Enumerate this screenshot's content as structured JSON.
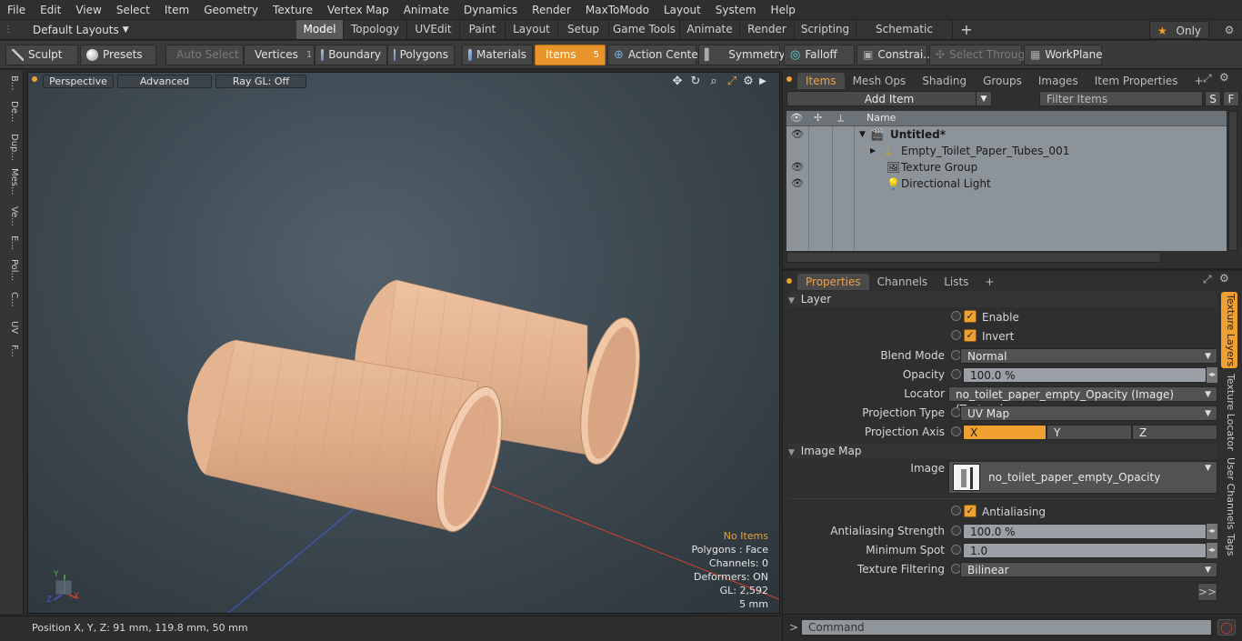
{
  "menu": [
    "File",
    "Edit",
    "View",
    "Select",
    "Item",
    "Geometry",
    "Texture",
    "Vertex Map",
    "Animate",
    "Dynamics",
    "Render",
    "MaxToModo",
    "Layout",
    "System",
    "Help"
  ],
  "layout_bar": {
    "layouts_label": "Default Layouts",
    "tabs": [
      "Model",
      "Topology",
      "UVEdit",
      "Paint",
      "Layout",
      "Setup",
      "Game Tools",
      "Animate",
      "Render",
      "Scripting",
      "Schematic Fusion"
    ],
    "active_tab": "Model",
    "add_label": "+",
    "only_label": "Only"
  },
  "toolbar": {
    "sculpt": "Sculpt",
    "presets": "Presets",
    "auto_select": "Auto Select",
    "vertices": "Vertices",
    "vertices_count": "1",
    "boundary": "Boundary",
    "polygons": "Polygons",
    "materials": "Materials",
    "items": "Items",
    "items_count": "5",
    "action_center": "Action Center",
    "symmetry": "Symmetry",
    "falloff": "Falloff",
    "constraints": "Constrai...",
    "select_through": "Select Through",
    "workplane": "WorkPlane"
  },
  "left_tabs": [
    "B...",
    "De...",
    "Dup...",
    "Mes...",
    "Ve...",
    "E...",
    "Pol...",
    "C...",
    "UV",
    "F..."
  ],
  "viewport": {
    "view_mode": "Perspective",
    "shading": "Advanced",
    "raygl": "Ray GL: Off",
    "hud": {
      "no_items": "No Items",
      "polygons": "Polygons : Face",
      "channels": "Channels: 0",
      "deformers": "Deformers: ON",
      "gl": "GL: 2,592",
      "units": "5 mm"
    },
    "axis": {
      "y": "Y",
      "x": "X",
      "z": "Z"
    },
    "colors": {
      "tube": "#e2b08c",
      "x_axis": "#d2432e",
      "z_axis": "#3d5fd6",
      "hud_highlight": "#f0a030"
    }
  },
  "status": {
    "position": "Position X, Y, Z:  91 mm, 119.8 mm, 50 mm"
  },
  "items_panel": {
    "tabs": [
      "Items",
      "Mesh Ops",
      "Shading",
      "Groups",
      "Images",
      "Item Properties"
    ],
    "active_tab": "Items",
    "add_item": "Add Item",
    "filter_placeholder": "Filter Items",
    "s_btn": "S",
    "f_btn": "F",
    "name_header": "Name",
    "tree": [
      {
        "name": "Untitled*"
      },
      {
        "name": "Empty_Toilet_Paper_Tubes_001"
      },
      {
        "name": "Texture Group"
      },
      {
        "name": "Directional Light"
      }
    ]
  },
  "properties_panel": {
    "tabs": [
      "Properties",
      "Channels",
      "Lists"
    ],
    "active_tab": "Properties",
    "side_tabs": [
      "Texture Layers",
      "Texture Locator",
      "User Channels",
      "Tags"
    ],
    "layer_section": "Layer",
    "enable": "Enable",
    "invert": "Invert",
    "blend_mode_label": "Blend Mode",
    "blend_mode": "Normal",
    "opacity_label": "Opacity",
    "opacity": "100.0 %",
    "locator_label": "Locator",
    "locator": "no_toilet_paper_empty_Opacity (Image) (Texture)",
    "projection_type_label": "Projection Type",
    "projection_type": "UV Map",
    "projection_axis_label": "Projection Axis",
    "axis_x": "X",
    "axis_y": "Y",
    "axis_z": "Z",
    "image_map_section": "Image Map",
    "image_label": "Image",
    "image": "no_toilet_paper_empty_Opacity",
    "antialiasing": "Antialiasing",
    "aa_strength_label": "Antialiasing Strength",
    "aa_strength": "100.0 %",
    "min_spot_label": "Minimum Spot",
    "min_spot": "1.0",
    "filtering_label": "Texture Filtering",
    "filtering": "Bilinear",
    "more": ">>"
  },
  "command": {
    "prompt": ">",
    "placeholder": "Command"
  }
}
